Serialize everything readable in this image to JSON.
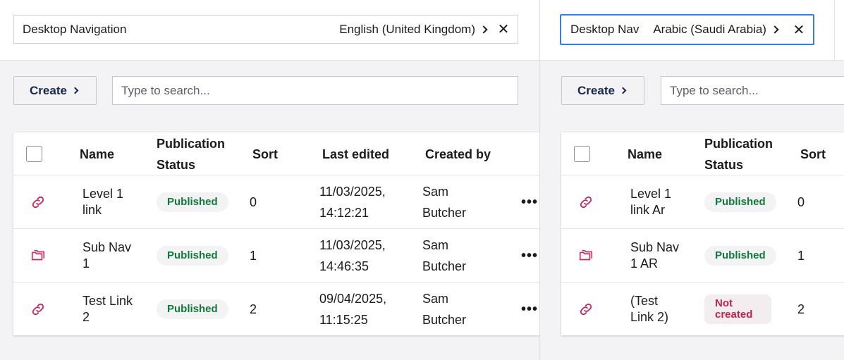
{
  "colors": {
    "accent": "#3f7ad8",
    "icon": "#c7285f",
    "published": "#0f7a3a",
    "not_created": "#c0234a",
    "text": "#1b264f"
  },
  "panes": {
    "left": {
      "variant": {
        "name": "Desktop Navigation",
        "language": "English (United Kingdom)"
      },
      "toolbar": {
        "create_label": "Create",
        "search_placeholder": "Type to search..."
      },
      "columns": {
        "name": "Name",
        "status": "Publication Status",
        "sort": "Sort",
        "last_edited": "Last edited",
        "created_by": "Created by"
      },
      "rows": [
        {
          "icon": "link-icon",
          "name": "Level 1 link",
          "status": "Published",
          "sort": "0",
          "last_edited": "11/03/2025, 14:12:21",
          "created_by": "Sam Butcher"
        },
        {
          "icon": "folder-icon",
          "name": "Sub Nav 1",
          "status": "Published",
          "sort": "1",
          "last_edited": "11/03/2025, 14:46:35",
          "created_by": "Sam Butcher"
        },
        {
          "icon": "link-icon",
          "name": "Test Link 2",
          "status": "Published",
          "sort": "2",
          "last_edited": "09/04/2025, 11:15:25",
          "created_by": "Sam Butcher"
        }
      ]
    },
    "right": {
      "variant": {
        "name": "Desktop Nav",
        "language": "Arabic (Saudi Arabia)"
      },
      "toolbar": {
        "create_label": "Create",
        "search_placeholder": "Type to search..."
      },
      "columns": {
        "name": "Name",
        "status": "Publication Status",
        "sort": "Sort"
      },
      "rows": [
        {
          "icon": "link-icon",
          "name": "Level 1 link Ar",
          "status": "Published",
          "sort": "0"
        },
        {
          "icon": "folder-icon",
          "name": "Sub Nav 1 AR",
          "status": "Published",
          "sort": "1"
        },
        {
          "icon": "link-icon",
          "name": "(Test Link 2)",
          "status": "Not created",
          "sort": "2"
        }
      ]
    }
  }
}
